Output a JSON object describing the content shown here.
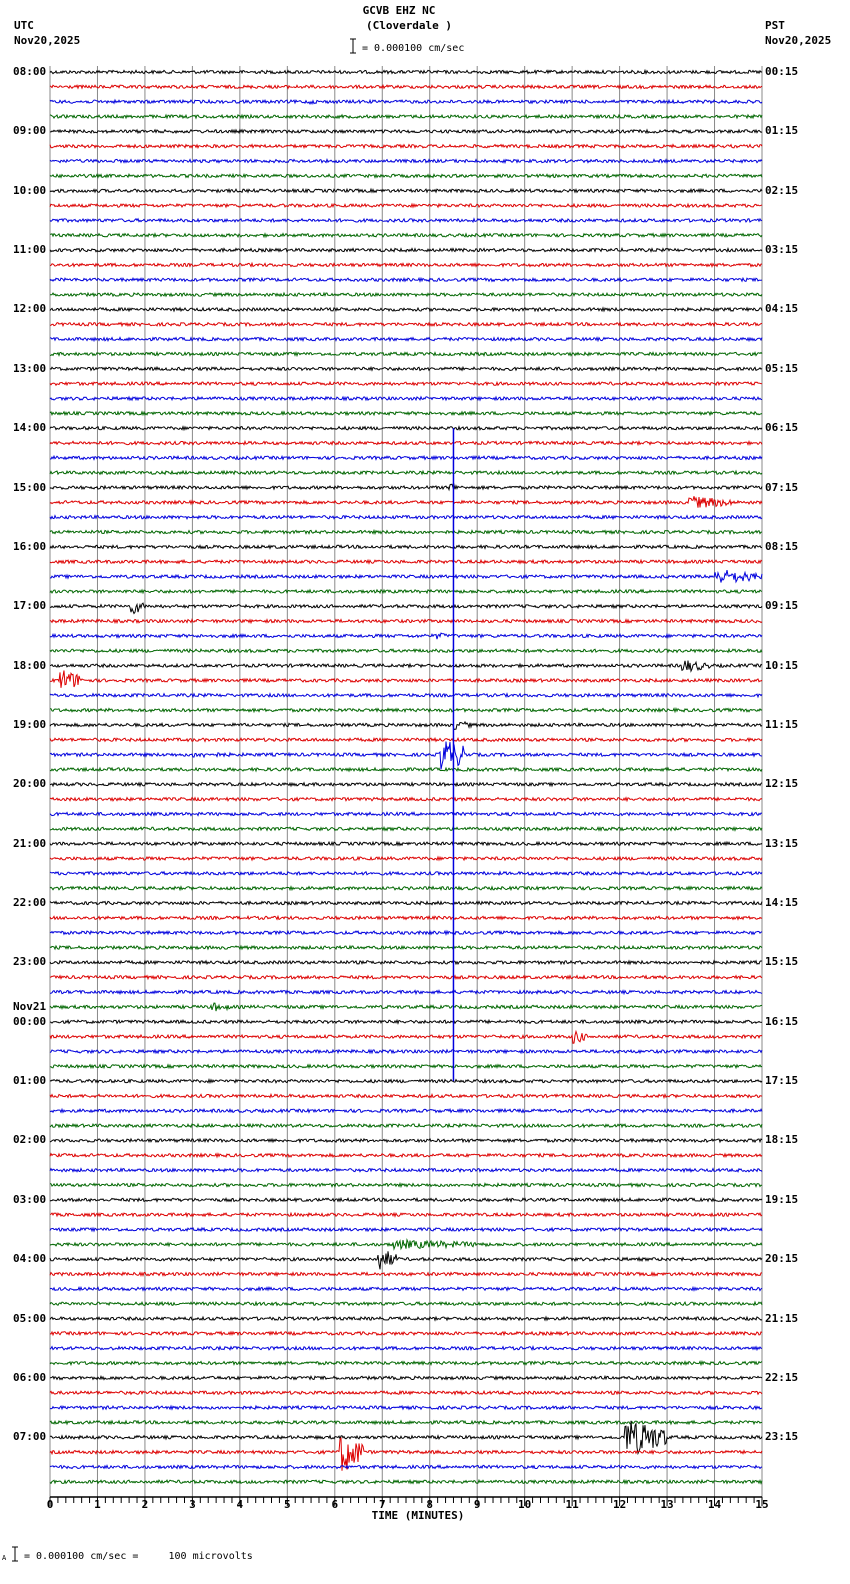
{
  "header": {
    "station": "GCVB EHZ NC",
    "location": "(Cloverdale )",
    "scale": "= 0.000100 cm/sec",
    "left_tz": "UTC",
    "left_date": "Nov20,2025",
    "right_tz": "PST",
    "right_date": "Nov20,2025"
  },
  "footer": {
    "scale_note": "= 0.000100 cm/sec =     100 microvolts",
    "mark": "A"
  },
  "chart_data": {
    "type": "line",
    "title": "GCVB EHZ NC (Cloverdale )",
    "xlabel": "TIME (MINUTES)",
    "xlim": [
      0,
      15
    ],
    "x_ticks": [
      "0",
      "1",
      "2",
      "3",
      "4",
      "5",
      "6",
      "7",
      "8",
      "9",
      "10",
      "11",
      "12",
      "13",
      "14",
      "15"
    ],
    "trace_count": 96,
    "trace_minutes": 15,
    "trace_colors": [
      "#000000",
      "#dd0000",
      "#0000dd",
      "#006600"
    ],
    "left_labels": [
      "08:00",
      "09:00",
      "10:00",
      "11:00",
      "12:00",
      "13:00",
      "14:00",
      "15:00",
      "16:00",
      "17:00",
      "18:00",
      "19:00",
      "20:00",
      "21:00",
      "22:00",
      "23:00",
      "00:00",
      "01:00",
      "02:00",
      "03:00",
      "04:00",
      "05:00",
      "06:00",
      "07:00"
    ],
    "date_change_label": "Nov21",
    "right_labels": [
      "00:15",
      "01:15",
      "02:15",
      "03:15",
      "04:15",
      "05:15",
      "06:15",
      "07:15",
      "08:15",
      "09:15",
      "10:15",
      "11:15",
      "12:15",
      "13:15",
      "14:15",
      "15:15",
      "16:15",
      "17:15",
      "18:15",
      "19:15",
      "20:15",
      "21:15",
      "22:15",
      "23:15"
    ],
    "events": [
      {
        "trace": 2,
        "minute": 5.4,
        "duration": 0.3,
        "amplitude": 3
      },
      {
        "trace": 28,
        "minute": 8.4,
        "duration": 0.2,
        "amplitude": 6
      },
      {
        "trace": 29,
        "minute": 13.4,
        "duration": 1.0,
        "amplitude": 7
      },
      {
        "trace": 34,
        "minute": 14.0,
        "duration": 1.0,
        "amplitude": 8
      },
      {
        "trace": 36,
        "minute": 1.7,
        "duration": 0.3,
        "amplitude": 9
      },
      {
        "trace": 38,
        "minute": 8.1,
        "duration": 0.3,
        "amplitude": 4
      },
      {
        "trace": 40,
        "minute": 13.3,
        "duration": 0.6,
        "amplitude": 7
      },
      {
        "trace": 41,
        "minute": 0.2,
        "duration": 0.5,
        "amplitude": 12
      },
      {
        "trace": 44,
        "minute": 8.5,
        "duration": 0.4,
        "amplitude": 5
      },
      {
        "trace": 46,
        "minute": 8.2,
        "duration": 0.6,
        "amplitude": 18
      },
      {
        "trace": 46,
        "minute": 3.0,
        "duration": 1.2,
        "amplitude": 3
      },
      {
        "trace": 63,
        "minute": 3.4,
        "duration": 0.4,
        "amplitude": 5
      },
      {
        "trace": 65,
        "minute": 11.0,
        "duration": 0.3,
        "amplitude": 8
      },
      {
        "trace": 79,
        "minute": 7.2,
        "duration": 2.0,
        "amplitude": 5
      },
      {
        "trace": 80,
        "minute": 6.9,
        "duration": 0.4,
        "amplitude": 12
      },
      {
        "trace": 92,
        "minute": 12.1,
        "duration": 0.9,
        "amplitude": 20
      },
      {
        "trace": 93,
        "minute": 6.1,
        "duration": 0.5,
        "amplitude": 22
      }
    ],
    "spike_line": {
      "minute": 8.5,
      "from_trace": 24,
      "to_trace": 68
    }
  }
}
